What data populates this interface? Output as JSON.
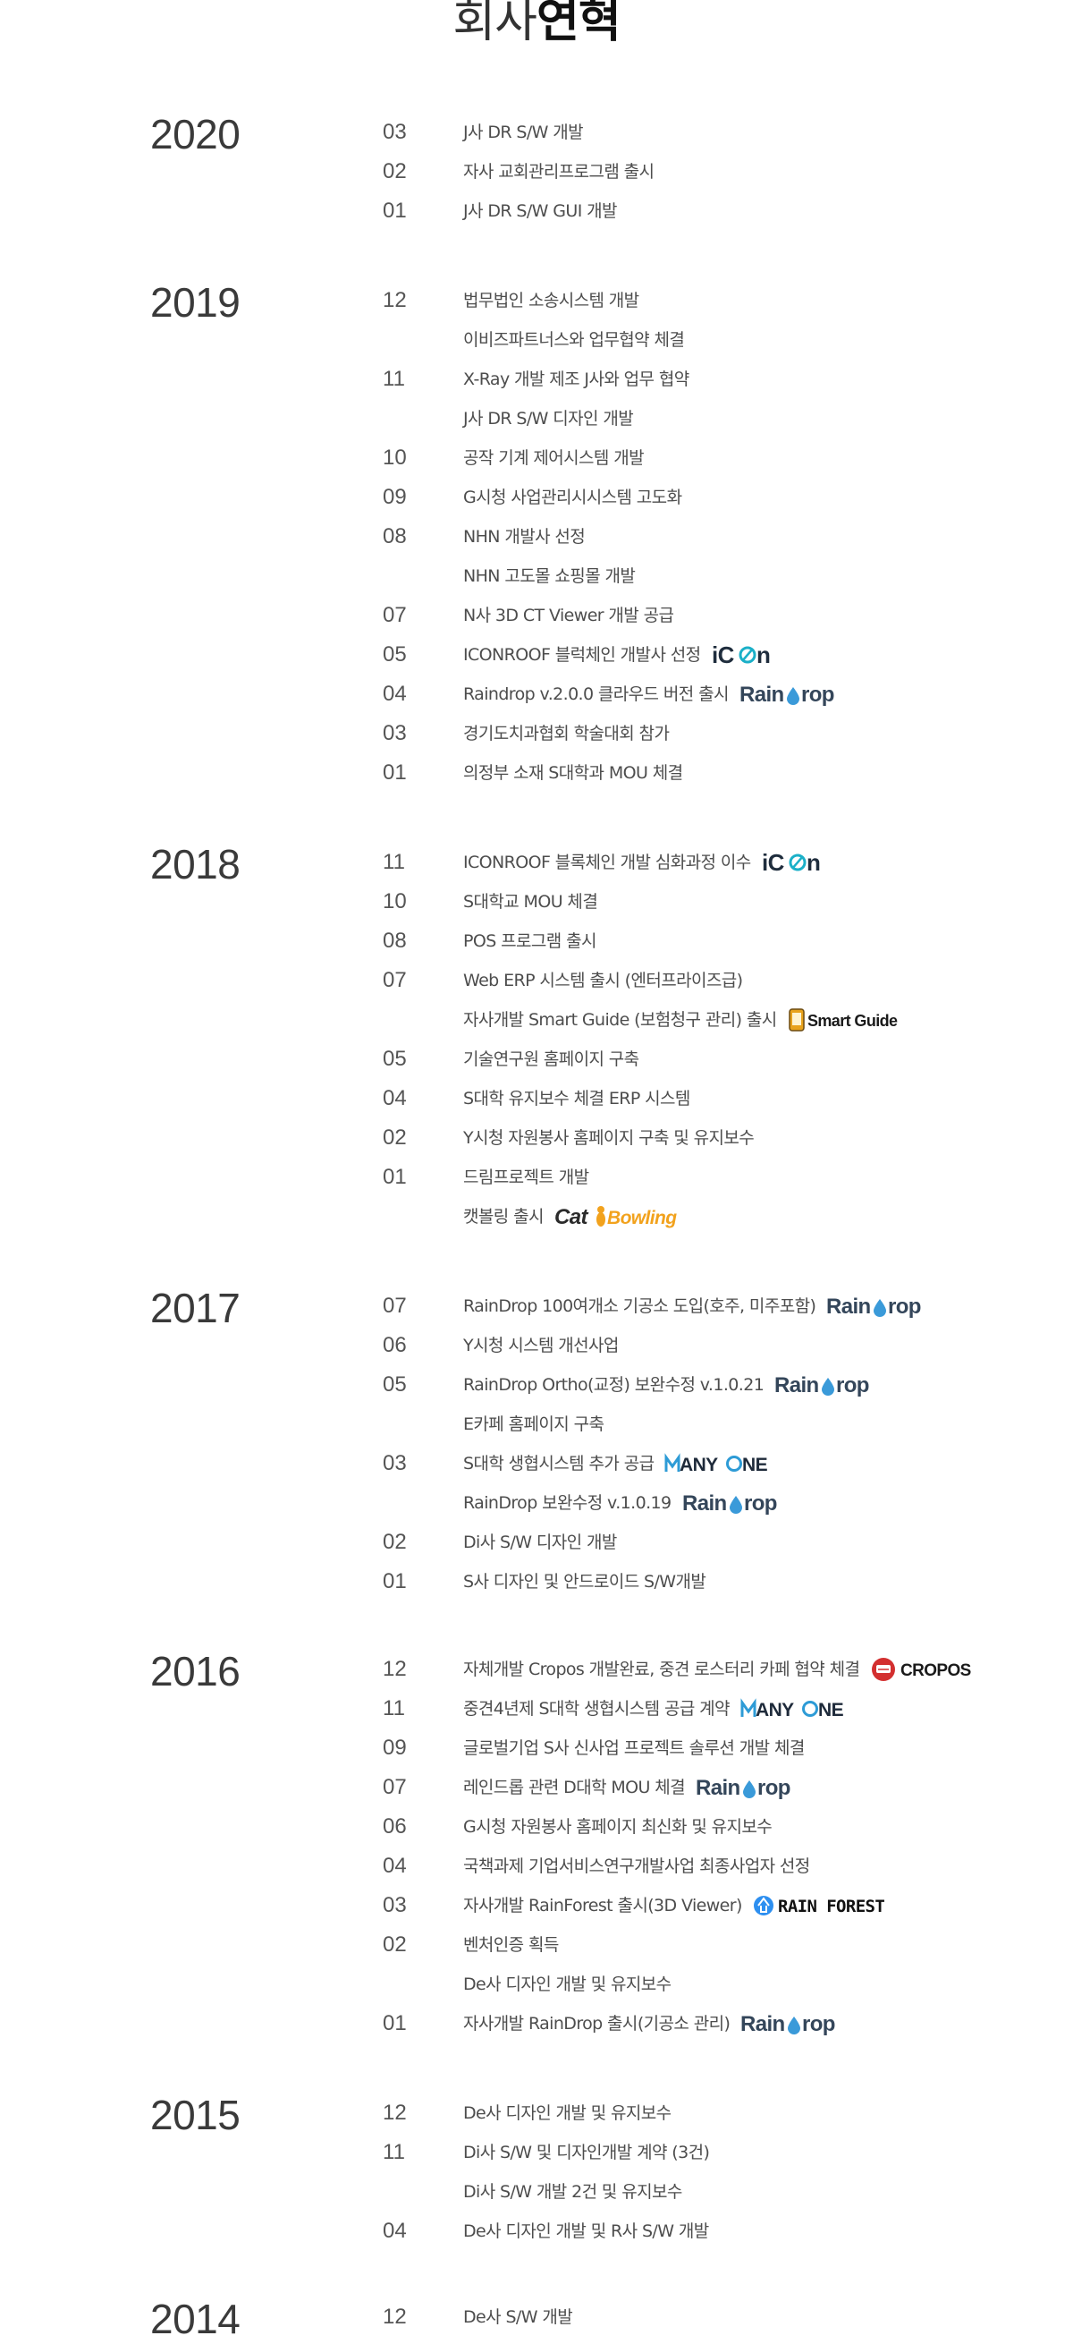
{
  "title": {
    "light": "회사",
    "bold": "연혁"
  },
  "timeline": [
    {
      "year": "2020",
      "entries": [
        {
          "month": "03",
          "text": "J사 DR S/W 개발"
        },
        {
          "month": "02",
          "text": "자사 교회관리프로그램 출시"
        },
        {
          "month": "01",
          "text": "J사 DR S/W GUI 개발"
        }
      ]
    },
    {
      "year": "2019",
      "entries": [
        {
          "month": "12",
          "text": "법무법인 소송시스템 개발"
        },
        {
          "month": "",
          "text": "이비즈파트너스와 업무협약 체결"
        },
        {
          "month": "11",
          "text": "X-Ray 개발 제조 J사와 업무 협약"
        },
        {
          "month": "",
          "text": "J사 DR S/W 디자인 개발"
        },
        {
          "month": "10",
          "text": "공작 기계 제어시스템 개발"
        },
        {
          "month": "09",
          "text": "G시청 사업관리시시스템 고도화"
        },
        {
          "month": "08",
          "text": "NHN 개발사 선정"
        },
        {
          "month": "",
          "text": "NHN 고도몰 쇼핑몰 개발"
        },
        {
          "month": "07",
          "text": "N사 3D CT Viewer 개발 공급"
        },
        {
          "month": "05",
          "text": "ICONROOF 블럭체인 개발사 선정",
          "logo": "icon"
        },
        {
          "month": "04",
          "text": "Raindrop v.2.0.0 클라우드 버전 출시",
          "logo": "raindrop"
        },
        {
          "month": "03",
          "text": "경기도치과협회 학술대회 참가"
        },
        {
          "month": "01",
          "text": "의정부 소재 S대학과 MOU 체결"
        }
      ]
    },
    {
      "year": "2018",
      "entries": [
        {
          "month": "11",
          "text": "ICONROOF 블록체인 개발 심화과정 이수",
          "logo": "icon"
        },
        {
          "month": "10",
          "text": "S대학교 MOU 체결"
        },
        {
          "month": "08",
          "text": "POS 프로그램 출시"
        },
        {
          "month": "07",
          "text": "Web ERP 시스템 출시 (엔터프라이즈급)"
        },
        {
          "month": "",
          "text": "자사개발 Smart Guide (보험청구 관리) 출시",
          "logo": "smartguide"
        },
        {
          "month": "05",
          "text": "기술연구원 홈페이지 구축"
        },
        {
          "month": "04",
          "text": "S대학 유지보수 체결 ERP 시스템"
        },
        {
          "month": "02",
          "text": "Y시청 자원봉사 홈페이지 구축 및 유지보수"
        },
        {
          "month": "01",
          "text": "드림프로젝트 개발"
        },
        {
          "month": "",
          "text": "캣볼링 출시",
          "logo": "catbowling"
        }
      ]
    },
    {
      "year": "2017",
      "entries": [
        {
          "month": "07",
          "text": "RainDrop 100여개소 기공소 도입(호주, 미주포함)",
          "logo": "raindrop"
        },
        {
          "month": "06",
          "text": "Y시청 시스템 개선사업"
        },
        {
          "month": "05",
          "text": "RainDrop Ortho(교정) 보완수정 v.1.0.21",
          "logo": "raindrop"
        },
        {
          "month": "",
          "text": "E카페 홈페이지 구축"
        },
        {
          "month": "03",
          "text": "S대학 생협시스템 추가 공급",
          "logo": "anyone"
        },
        {
          "month": "",
          "text": "RainDrop 보완수정 v.1.0.19",
          "logo": "raindrop"
        },
        {
          "month": "02",
          "text": "Di사 S/W 디자인 개발"
        },
        {
          "month": "01",
          "text": "S사 디자인 및 안드로이드 S/W개발"
        }
      ]
    },
    {
      "year": "2016",
      "entries": [
        {
          "month": "12",
          "text": "자체개발 Cropos 개발완료, 중견 로스터리 카페 협약 체결",
          "logo": "cropos"
        },
        {
          "month": "11",
          "text": "중견4년제 S대학 생협시스템 공급 계약",
          "logo": "anyone"
        },
        {
          "month": "09",
          "text": "글로벌기업 S사 신사업 프로젝트 솔루션 개발 체결"
        },
        {
          "month": "07",
          "text": "레인드롭 관련 D대학 MOU 체결",
          "logo": "raindrop"
        },
        {
          "month": "06",
          "text": "G시청 자원봉사 홈페이지 최신화 및 유지보수"
        },
        {
          "month": "04",
          "text": "국책과제 기업서비스연구개발사업 최종사업자 선정"
        },
        {
          "month": "03",
          "text": "자사개발 RainForest 출시(3D Viewer)",
          "logo": "rainforest"
        },
        {
          "month": "02",
          "text": "벤처인증 획득"
        },
        {
          "month": "",
          "text": "De사 디자인 개발 및 유지보수"
        },
        {
          "month": "01",
          "text": "자사개발 RainDrop 출시(기공소 관리)",
          "logo": "raindrop"
        }
      ]
    },
    {
      "year": "2015",
      "entries": [
        {
          "month": "12",
          "text": "De사 디자인 개발 및 유지보수"
        },
        {
          "month": "11",
          "text": "Di사 S/W 및 디자인개발 계약 (3건)"
        },
        {
          "month": "",
          "text": "Di사 S/W 개발 2건 및 유지보수"
        },
        {
          "month": "04",
          "text": "De사 디자인 개발 및 R사 S/W 개발"
        }
      ]
    },
    {
      "year": "2014",
      "entries": [
        {
          "month": "12",
          "text": "De사 S/W 개발"
        }
      ]
    }
  ],
  "logos": {
    "icon": {
      "text_a": "iC",
      "text_b": "N",
      "color_dark": "#1f2d3d",
      "color_accent": "#1bb0c8"
    },
    "raindrop": {
      "text_a": "Rain",
      "text_b": "rop",
      "color_dark": "#34465a",
      "color_drop": "#3a9ad9"
    },
    "smartguide": {
      "text": "Smart Guide",
      "color": "#1a1a1a"
    },
    "catbowling": {
      "text_a": "Cat",
      "text_b": "Bowling",
      "color_dark": "#2b2b2b",
      "color_accent": "#f2a21d"
    },
    "anyone": {
      "text": "ANY",
      "text_b": "NE",
      "color": "#1e2a3a",
      "color_accent": "#2d9bd6"
    },
    "cropos": {
      "text": "CROPOS",
      "color": "#1a1a1a",
      "color_accent": "#d32f2f"
    },
    "rainforest": {
      "text_a": "RAIN ",
      "text_b": "FOREST",
      "color": "#111",
      "color_accent": "#2d8ff0"
    }
  }
}
